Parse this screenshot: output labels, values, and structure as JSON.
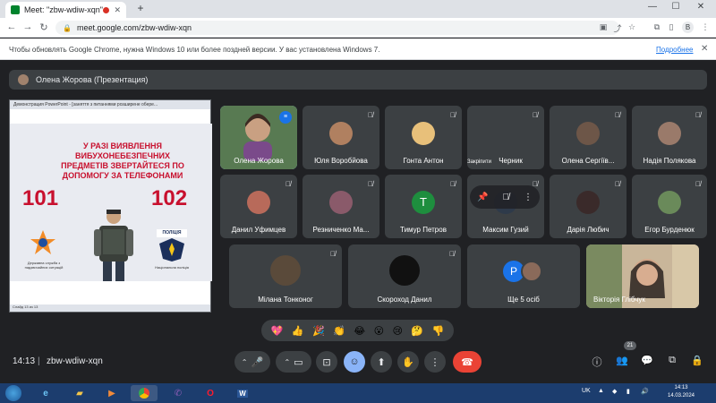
{
  "browser": {
    "tab_title": "Meet: \"zbw-wdiw-xqn\"",
    "url": "meet.google.com/zbw-wdiw-xqn",
    "profile_initial": "B"
  },
  "infobar": {
    "message": "Чтобы обновлять Google Chrome, нужна Windows 10 или более поздней версии. У вас установлена Windows 7.",
    "link": "Подробнее"
  },
  "presentation": {
    "presenter_label": "Олена Жорова (Презентация)",
    "window_title": "Демонстрация PowerPoint - [заняття з питаннями розширене обере...",
    "headline": "У РАЗІ ВИЯВЛЕННЯ ВИБУХОНЕБЕЗПЕЧНИХ ПРЕДМЕТІВ ЗВЕРТАЙТЕСЯ ПО ДОПОМОГУ ЗА ТЕЛЕФОНАМИ",
    "number_left": "101",
    "number_right": "102",
    "caption_left": "Державна служба з надзвичайних ситуацій",
    "police_word": "ПОЛІЦІЯ",
    "caption_right": "Національна поліція",
    "status_text": "Слайд 13 из 13"
  },
  "participants": [
    {
      "name": "Олена Жорова"
    },
    {
      "name": "Юля Воробйова"
    },
    {
      "name": "Гонта Антон"
    },
    {
      "name": "Черник"
    },
    {
      "name": "Олена Сергіїв..."
    },
    {
      "name": "Надія Полякова"
    },
    {
      "name": "Данил Уфимцев"
    },
    {
      "name": "Резниченко Ма..."
    },
    {
      "name": "Тимур Петров",
      "initial": "Т"
    },
    {
      "name": "Максим Гузий"
    },
    {
      "name": "Дарія Любич"
    },
    {
      "name": "Егор Бурденюк"
    },
    {
      "name": "Мілана Тонконог"
    },
    {
      "name": "Скороход Данил"
    },
    {
      "name": "Ще 5 осіб",
      "initial": "Р"
    },
    {
      "name": "Вікторія Глібчук"
    }
  ],
  "hover_controls": {
    "pin_label": "Закріпити"
  },
  "reactions": [
    "💖",
    "👍",
    "🎉",
    "👏",
    "😂",
    "😮",
    "😢",
    "🤔",
    "👎"
  ],
  "bottom_bar": {
    "time": "14:13",
    "code": "zbw-wdiw-xqn",
    "people_count": "21"
  },
  "taskbar": {
    "lang": "UK",
    "time": "14:13",
    "date": "14.03.2024"
  },
  "colors": {
    "meet_bg": "#202124",
    "tile_bg": "#3c4043",
    "hangup": "#ea4335",
    "accent": "#8ab4f8",
    "slide_red": "#c8102e"
  }
}
